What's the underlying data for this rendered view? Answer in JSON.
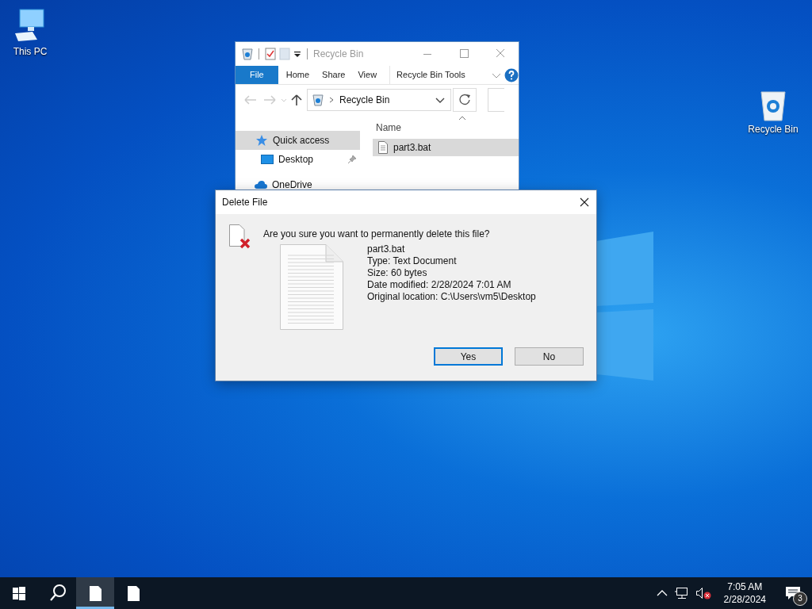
{
  "desktop_icons": [
    {
      "label": "This PC",
      "kind": "computer"
    },
    {
      "label": "Recycle Bin",
      "kind": "recycle"
    }
  ],
  "explorer": {
    "title": "Recycle Bin",
    "ribbon_tabs": [
      {
        "label": "File",
        "kind": "file"
      },
      {
        "label": "Home",
        "kind": "tab"
      },
      {
        "label": "Share",
        "kind": "tab"
      },
      {
        "label": "View",
        "kind": "tab"
      },
      {
        "label": "Recycle Bin Tools",
        "kind": "context"
      }
    ],
    "address": "Recycle Bin",
    "column": "Name",
    "sidebar": [
      {
        "label": "Quick access",
        "kind": "star",
        "selected": true,
        "pinned": false
      },
      {
        "label": "Desktop",
        "kind": "desktop",
        "selected": false,
        "pinned": true
      },
      {
        "label": "OneDrive",
        "kind": "cloud",
        "selected": false,
        "pinned": false
      }
    ],
    "files": [
      {
        "name": "part3.bat",
        "selected": true
      }
    ]
  },
  "dialog": {
    "title": "Delete File",
    "question": "Are you sure you want to permanently delete this file?",
    "details": [
      "part3.bat",
      "Type: Text Document",
      "Size: 60 bytes",
      "Date modified: 2/28/2024 7:01 AM",
      "Original location: C:\\Users\\vm5\\Desktop"
    ],
    "buttons": [
      {
        "label": "Yes",
        "default": true
      },
      {
        "label": "No",
        "default": false
      }
    ]
  },
  "taskbar": {
    "apps": [
      {
        "kind": "document",
        "selected": true
      },
      {
        "kind": "document",
        "selected": false
      }
    ],
    "time": "7:05 AM",
    "date": "2/28/2024",
    "notifications": "3"
  }
}
